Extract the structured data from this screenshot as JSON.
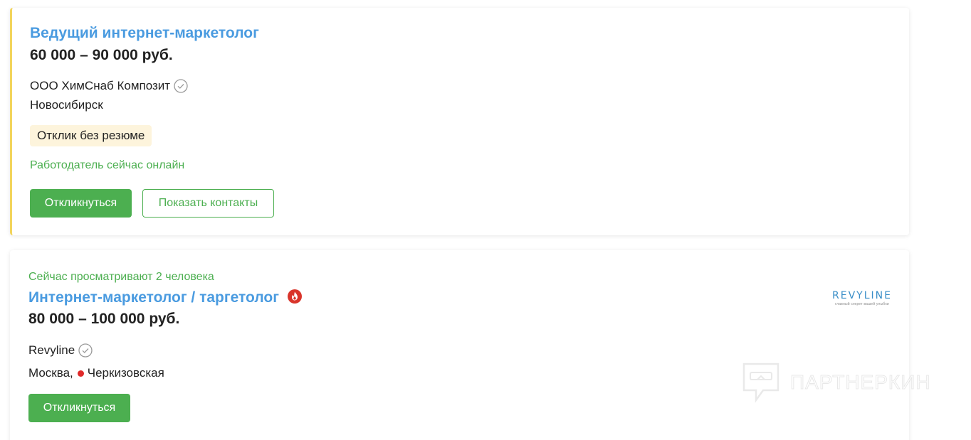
{
  "vacancies": [
    {
      "title": "Ведущий интернет-маркетолог",
      "salary": "60 000 – 90 000 руб.",
      "company": "ООО ХимСнаб Композит",
      "city": "Новосибирск",
      "badge": "Отклик без резюме",
      "status": "Работодатель сейчас онлайн",
      "apply_label": "Откликнуться",
      "contacts_label": "Показать контакты",
      "accent_color": "#f2d45c"
    },
    {
      "viewers": "Сейчас просматривают 2 человека",
      "title": "Интернет-маркетолог / таргетолог",
      "salary": "80 000 – 100 000 руб.",
      "company": "Revyline",
      "city": "Москва,",
      "metro": "Черкизовская",
      "metro_color": "#e02a2a",
      "apply_label": "Откликнуться",
      "logo": {
        "word": "REVYLINE",
        "tagline": "главный секрет вашей улыбки"
      }
    }
  ],
  "watermark": "ПАРТНЕРКИН",
  "colors": {
    "link": "#4a9be0",
    "green": "#4caf50",
    "badge_bg": "#fdf4dc"
  }
}
